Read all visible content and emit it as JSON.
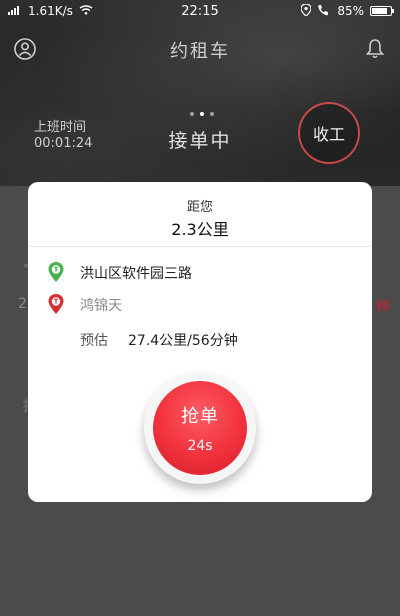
{
  "status_bar": {
    "network_speed": "1.61K/s",
    "time": "22:15",
    "battery": "85%",
    "battery_level": 0.85
  },
  "nav": {
    "title": "约租车"
  },
  "work": {
    "label": "上班时间",
    "timer": "00:01:24"
  },
  "order_status": "接单中",
  "offwork_button": "收工",
  "background_hints": {
    "left_top": "<",
    "left_mid": "2",
    "right": "钟",
    "left_low": "扌"
  },
  "dialog": {
    "distance_label": "距您",
    "distance_value": "2.3公里",
    "from": "洪山区软件园三路",
    "to": "鸿锦天",
    "estimate_label": "预估",
    "estimate_value": "27.4公里/56分钟"
  },
  "grab_button": {
    "label": "抢单",
    "countdown": "24s"
  },
  "colors": {
    "accent_red": "#f0323c",
    "from_green": "#4caf50",
    "to_red": "#d32f2f"
  }
}
